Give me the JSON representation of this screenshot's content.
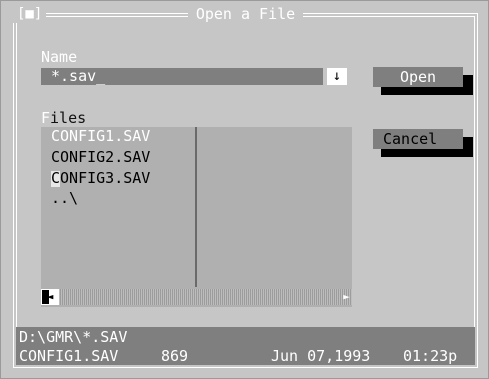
{
  "dialog": {
    "title": "Open a File",
    "close_box": "[■]"
  },
  "name_field": {
    "label_hotkey": "N",
    "label_rest": "ame",
    "value": "*.sav_",
    "dropdown_icon": "down-arrow-icon",
    "dropdown_glyph": "↓"
  },
  "files": {
    "label_hotkey": "F",
    "label_rest": "iles",
    "items": [
      "CONFIG1.SAV",
      "CONFIG2.SAV",
      "CONFIG3.SAV",
      "..\\"
    ],
    "selected_index": 0
  },
  "buttons": {
    "open_label": "Open",
    "cancel_label": "Cancel"
  },
  "scrollbar": {
    "left_glyph": "◄",
    "right_glyph": "►"
  },
  "status": {
    "path": "D:\\GMR\\*.SAV",
    "file_name": "CONFIG1.SAV",
    "file_size": "869",
    "file_date": "Jun 07,1993",
    "file_time": "01:23p"
  },
  "colors": {
    "background": "#c6c6c6",
    "accent": "#7f7f7f",
    "highlight": "#ffffff"
  }
}
